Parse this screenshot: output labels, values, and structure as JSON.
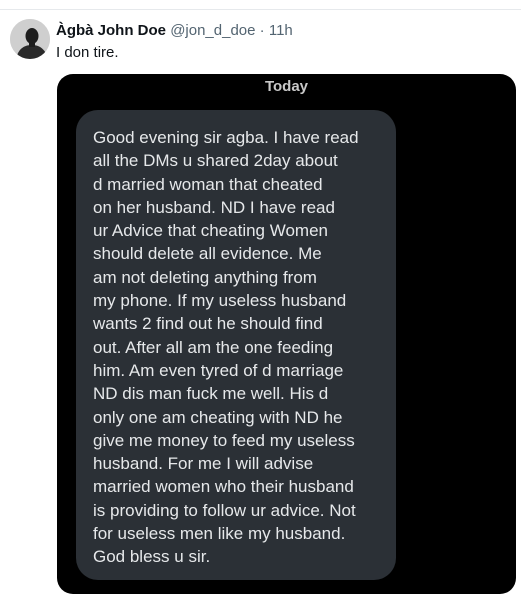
{
  "tweet": {
    "author_name": "Àgbà John Doe",
    "author_handle": "@jon_d_doe",
    "separator": "·",
    "time": "11h",
    "text": "I don tire."
  },
  "screenshot": {
    "date_label": "Today",
    "message": "Good evening sir agba. I have read\nall the DMs u shared 2day about\nd married woman that cheated\non her husband. ND I have read\nur Advice that cheating Women\nshould delete all evidence. Me\nam not deleting anything from\nmy phone. If my useless husband\nwants 2 find out he should find\nout. After all am the one feeding\nhim. Am even tyred of d marriage\nND dis man fuck me well. His d\nonly one am cheating with ND he\ngive me money to feed my useless\nhusband. For me I will advise\nmarried women who their husband\nis providing to follow ur advice. Not\nfor useless men like my husband.\nGod bless u sir."
  },
  "colors": {
    "name": "#0f1419",
    "secondary": "#536471",
    "media_background": "#000000",
    "bubble": "#2b3036",
    "bubble_text": "#e6e8ea"
  },
  "icons": {
    "avatar": "person-silhouette"
  }
}
